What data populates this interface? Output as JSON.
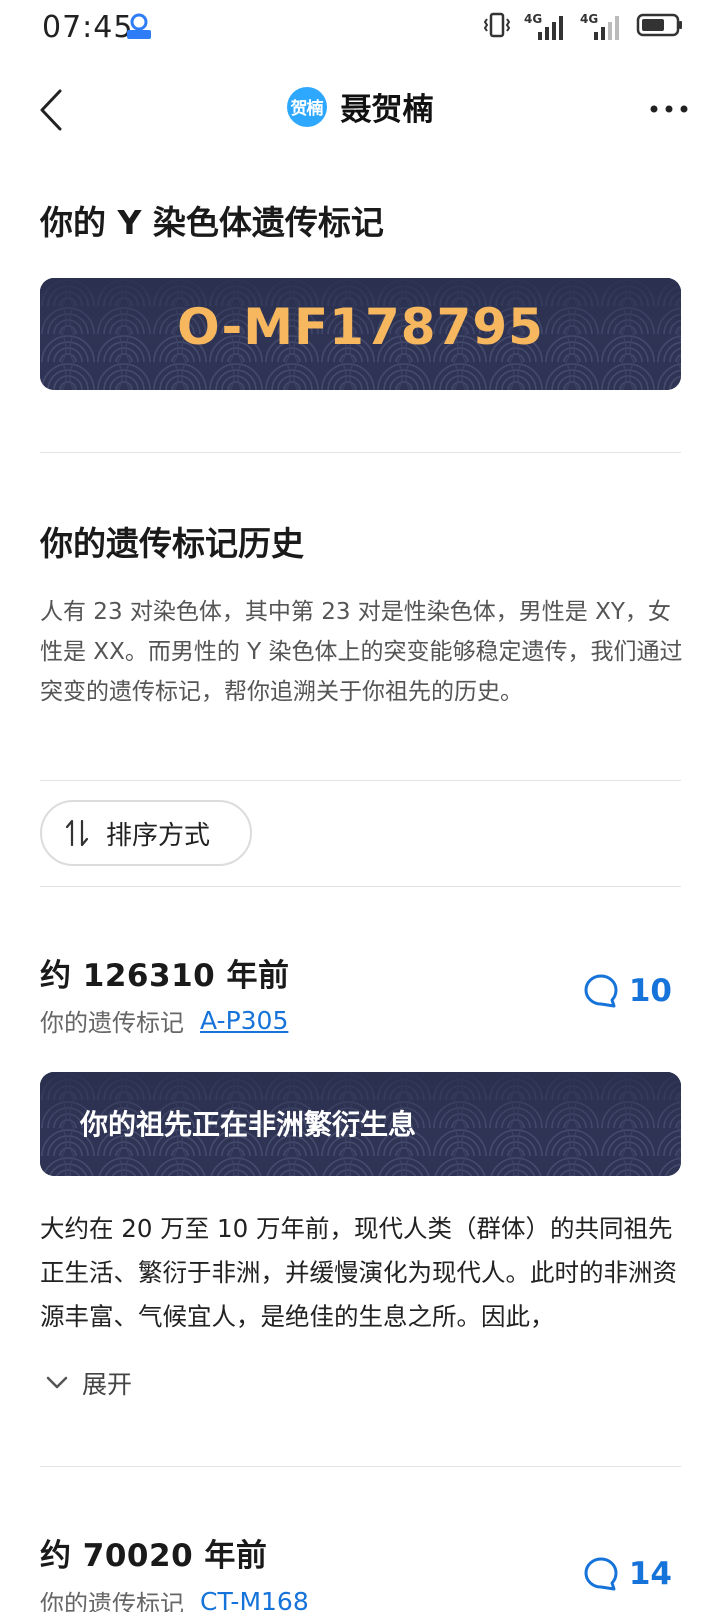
{
  "status_bar": {
    "time": "07:45",
    "network_label_1": "4G",
    "network_label_2": "4G"
  },
  "nav": {
    "avatar_text": "贺楠",
    "title": "聂贺楠"
  },
  "marker_section": {
    "heading": "你的 Y 染色体遗传标记",
    "marker": "O-MF178795"
  },
  "history_section": {
    "heading": "你的遗传标记历史",
    "description": "人有 23 对染色体，其中第 23 对是性染色体，男性是 XY，女性是 XX。而男性的 Y 染色体上的突变能够稳定遗传，我们通过突变的遗传标记，帮你追溯关于你祖先的历史。"
  },
  "sort": {
    "label": "排序方式"
  },
  "entries": [
    {
      "era": "约 126310 年前",
      "marker_prefix": "你的遗传标记",
      "marker": "A-P305",
      "comment_count": "10",
      "banner": "你的祖先正在非洲繁衍生息",
      "story": "大约在 20 万至 10 万年前，现代人类（群体）的共同祖先正生活、繁衍于非洲，并缓慢演化为现代人。此时的非洲资源丰富、气候宜人，是绝佳的生息之所。因此，",
      "expand_label": "展开"
    },
    {
      "era": "约 70020 年前",
      "marker_prefix": "你的遗传标记",
      "marker": "CT-M168",
      "comment_count": "14"
    }
  ],
  "colors": {
    "accent_blue": "#1673d9",
    "marker_gold": "#f6b75e",
    "card_navy": "#2f3454"
  }
}
